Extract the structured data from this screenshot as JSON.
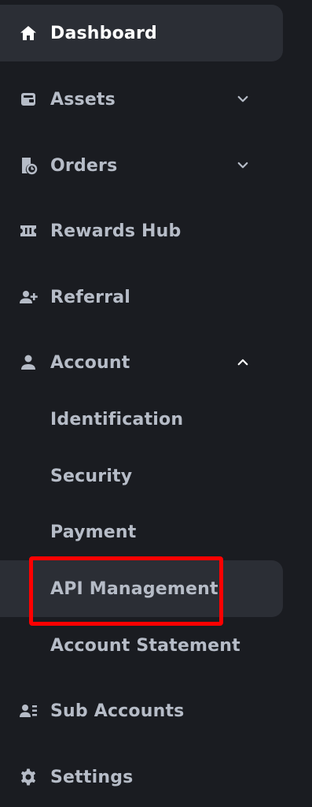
{
  "nav": {
    "dashboard": {
      "label": "Dashboard",
      "icon": "home-icon"
    },
    "assets": {
      "label": "Assets",
      "icon": "wallet-icon"
    },
    "orders": {
      "label": "Orders",
      "icon": "orders-icon"
    },
    "rewards": {
      "label": "Rewards Hub",
      "icon": "ticket-icon"
    },
    "referral": {
      "label": "Referral",
      "icon": "user-plus-icon"
    },
    "account": {
      "label": "Account",
      "icon": "user-icon",
      "children": [
        {
          "label": "Identification"
        },
        {
          "label": "Security"
        },
        {
          "label": "Payment"
        },
        {
          "label": "API Management"
        },
        {
          "label": "Account Statement"
        }
      ]
    },
    "sub_accounts": {
      "label": "Sub Accounts",
      "icon": "user-list-icon"
    },
    "settings": {
      "label": "Settings",
      "icon": "gear-icon"
    }
  },
  "colors": {
    "background": "#1a1c21",
    "active_background": "#2b2e35",
    "text": "#b6bcc7",
    "text_active": "#ffffff",
    "highlight": "#ff0000"
  }
}
